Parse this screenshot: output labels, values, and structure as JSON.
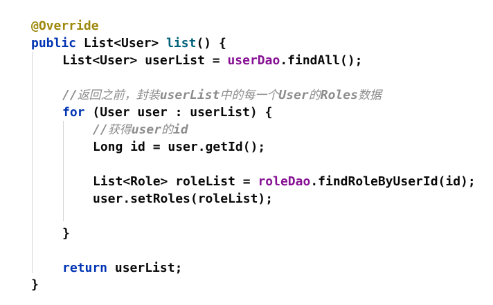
{
  "code": {
    "annotation": "@Override",
    "kw_public": "public",
    "return_type": "List<User>",
    "method_name": "list",
    "method_params": "() {",
    "l2_type": "List<User>",
    "l2_var": "userList",
    "l2_eq": "=",
    "l2_field": "userDao",
    "l2_call": ".findAll();",
    "c1_slashes": "//",
    "c1_t1": "返回之前，封装",
    "c1_t2": "userList",
    "c1_t3": "中的每一个",
    "c1_t4": "User",
    "c1_t5": "的",
    "c1_t6": "Roles",
    "c1_t7": "数据",
    "kw_for": "for",
    "for_rest": "(User user : userList) {",
    "c2_slashes": "//",
    "c2_t1": "获得",
    "c2_t2": "user",
    "c2_t3": "的",
    "c2_t4": "id",
    "l5": "Long id = user.getId();",
    "l6_type": "List<Role>",
    "l6_var": "roleList",
    "l6_eq": "=",
    "l6_field": "roleDao",
    "l6_call": ".findRoleByUserId(id);",
    "l7": "user.setRoles(roleList);",
    "close_for": "}",
    "kw_return": "return",
    "return_rest": "userList;",
    "close_method": "}"
  },
  "colors": {
    "keyword": "#0033b3",
    "annotation": "#9e880d",
    "method": "#00627a",
    "field": "#871094",
    "comment": "#8c8c8c",
    "text": "#080808"
  }
}
